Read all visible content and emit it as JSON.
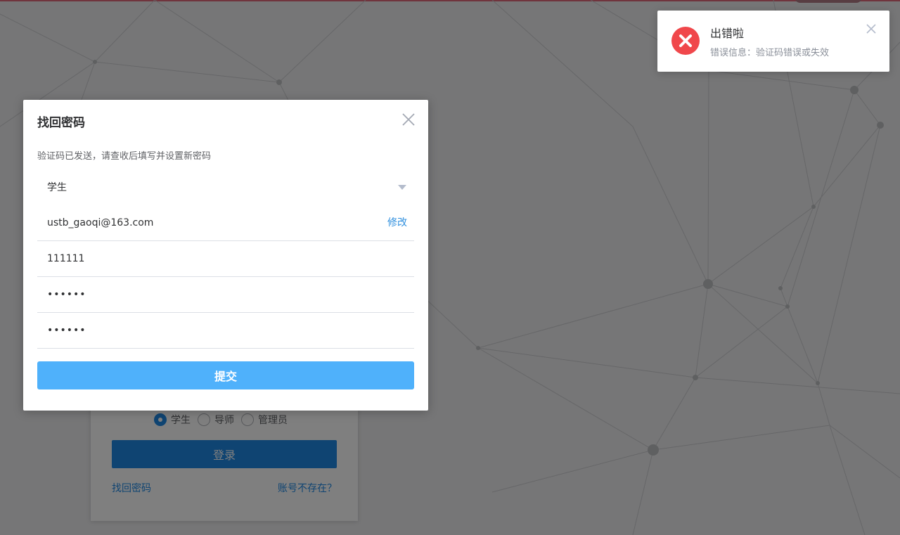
{
  "colors": {
    "primary": "#1e88e5",
    "submit": "#4fb1fb",
    "error": "#f0474b",
    "link": "#2f8fde"
  },
  "login": {
    "roles": [
      {
        "label": "学生",
        "checked": true
      },
      {
        "label": "导师",
        "checked": false
      },
      {
        "label": "管理员",
        "checked": false
      }
    ],
    "login_button": "登录",
    "forgot_link": "找回密码",
    "no_account_link": "账号不存在？"
  },
  "toast": {
    "icon": "error-circle-icon",
    "title": "出错啦",
    "message": "错误信息：验证码错误或失效",
    "close_icon": "close-icon"
  },
  "dialog": {
    "title": "找回密码",
    "close_icon": "close-icon",
    "hint": "验证码已发送，请查收后填写并设置新密码",
    "role_select": {
      "value": "学生"
    },
    "email": {
      "value": "ustb_gaoqi@163.com",
      "action": "修改"
    },
    "code": {
      "value": "111111"
    },
    "new_password": {
      "value": "123456"
    },
    "confirm_password": {
      "value": "123456"
    },
    "submit": "提交"
  }
}
